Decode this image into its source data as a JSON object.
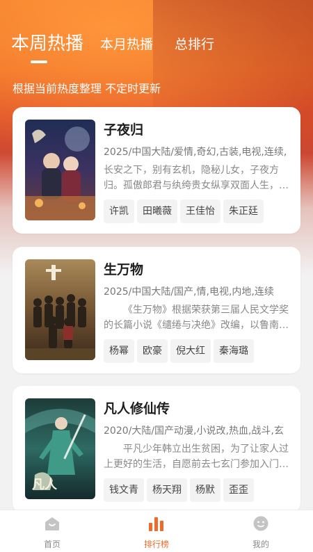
{
  "tabs": [
    {
      "label": "本周热播",
      "active": true
    },
    {
      "label": "本月热播",
      "active": false
    },
    {
      "label": "总排行",
      "active": false
    }
  ],
  "subtitle": "根据当前热度整理 不定时更新",
  "items": [
    {
      "title": "子夜归",
      "meta": "2025/中国大陆/爱情,奇幻,古装,电视,连续,",
      "desc": "长安之下，别有玄机，隐秘儿女，子夜方归。孤傲郎君与纨绔贵女纵享双面人生，携手破解迷案，共赴乱世侠情。",
      "actors": [
        "许凯",
        "田曦薇",
        "王佳怡",
        "朱正廷"
      ]
    },
    {
      "title": "生万物",
      "meta": "2025/中国大陆/国产,情,电视,内地,连续",
      "desc": "《生万物》根据荣获第三届人民文学奖的长篇小说《缱绻与决绝》改编，以鲁南农村为背景讲述土地与人的故事。",
      "actors": [
        "杨幂",
        "欧豪",
        "倪大红",
        "秦海璐"
      ]
    },
    {
      "title": "凡人修仙传",
      "meta": "2020/大陆/国产动漫,小说改,热血,战斗,玄",
      "desc": "平凡少年韩立出生贫困，为了让家人过上更好的生活，自愿前去七玄门参加入门考核，踏上修仙之路。",
      "actors": [
        "钱文青",
        "杨天翔",
        "杨默",
        "歪歪"
      ]
    }
  ],
  "nav": [
    {
      "label": "首页",
      "icon": "home-icon",
      "active": false
    },
    {
      "label": "排行榜",
      "icon": "bar-chart-icon",
      "active": true
    },
    {
      "label": "我的",
      "icon": "smiley-face-icon",
      "active": false
    }
  ],
  "colors": {
    "accent": "#ee6b2a",
    "inactive": "#bdbdbd"
  }
}
